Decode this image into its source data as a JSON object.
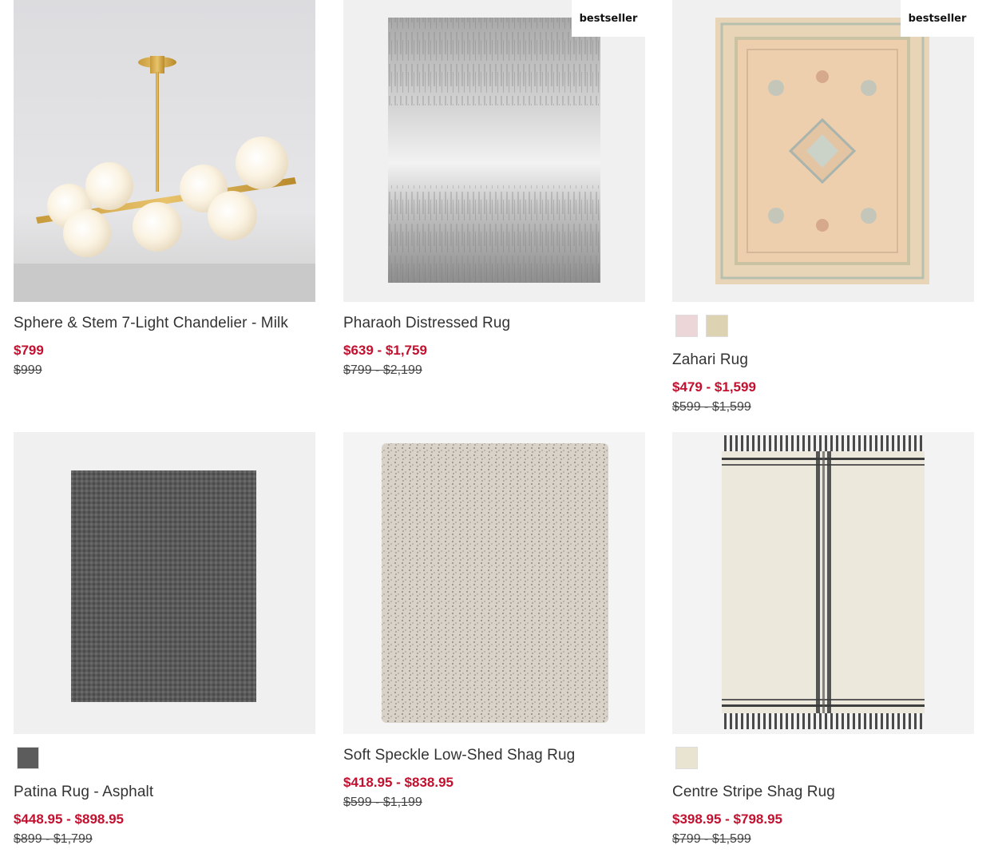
{
  "products": [
    {
      "name": "Sphere & Stem 7-Light Chandelier - Milk",
      "sale_price": "$799",
      "original_price": "$999",
      "image": "chandelier-image",
      "badge": "",
      "swatches": []
    },
    {
      "name": "Pharaoh Distressed Rug",
      "sale_price": "$639 - $1,759",
      "original_price": "$799 - $2,199",
      "image": "gray-distressed-rug-image",
      "badge": "bestseller",
      "swatches": []
    },
    {
      "name": "Zahari Rug",
      "sale_price": "$479 - $1,599",
      "original_price": "$599 - $1,599",
      "image": "peach-traditional-rug-image",
      "badge": "bestseller",
      "swatches": [
        "#ecd6d8",
        "#ddd2b2"
      ]
    },
    {
      "name": "Patina Rug - Asphalt",
      "sale_price": "$448.95 - $898.95",
      "original_price": "$899 - $1,799",
      "image": "charcoal-rug-image",
      "badge": "",
      "swatches": [
        "#5c5c5c"
      ]
    },
    {
      "name": "Soft Speckle Low-Shed Shag Rug",
      "sale_price": "$418.95 - $838.95",
      "original_price": "$599 - $1,199",
      "image": "speckle-shag-rug-image",
      "badge": "",
      "swatches": []
    },
    {
      "name": "Centre Stripe Shag Rug",
      "sale_price": "$398.95 - $798.95",
      "original_price": "$799 - $1,599",
      "image": "stripe-shag-rug-image",
      "badge": "",
      "swatches": [
        "#e9e4d2"
      ]
    }
  ],
  "colors": {
    "sale": "#c3102f",
    "image_background": "#f0f0f1"
  }
}
